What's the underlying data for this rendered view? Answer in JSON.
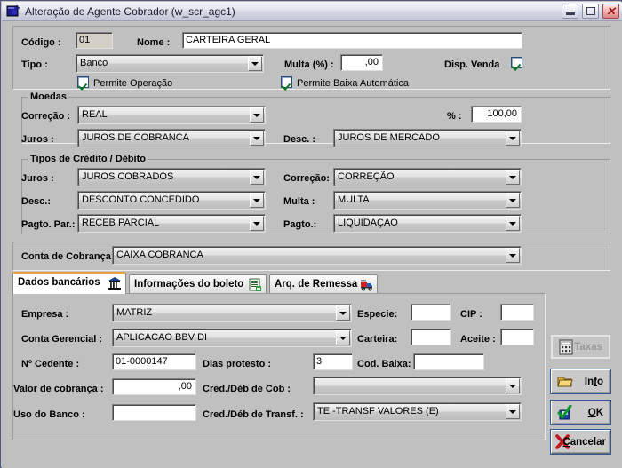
{
  "window": {
    "title": "Alteração de Agente Cobrador (w_scr_agc1)",
    "icon": "app-window-icon",
    "minimize": "minimize-icon",
    "maximize": "maximize-icon",
    "close": "close-icon"
  },
  "form": {
    "codigo_label": "Código :",
    "codigo_value": "01",
    "nome_label": "Nome :",
    "nome_value": "CARTEIRA GERAL",
    "tipo_label": "Tipo :",
    "tipo_value": "Banco",
    "multa_label": "Multa (%) :",
    "multa_value": ",00",
    "disp_venda_label": "Disp. Venda",
    "disp_venda_checked": true,
    "permite_operacao_label": "Permite Operação",
    "permite_operacao_checked": true,
    "permite_baixa_label": "Permite Baixa Automática",
    "permite_baixa_checked": true
  },
  "moedas": {
    "group_title": "Moedas",
    "correcao_label": "Correção :",
    "correcao_value": "REAL",
    "pct_label": "% :",
    "pct_value": "100,00",
    "juros_label": "Juros :",
    "juros_value": "JUROS DE COBRANCA",
    "desc_label": "Desc. :",
    "desc_value": "JUROS DE MERCADO"
  },
  "tipos_credito": {
    "group_title": "Tipos de Crédito / Débito",
    "juros_label": "Juros :",
    "juros_value": "JUROS COBRADOS",
    "correcao_label": "Correção:",
    "correcao_value": "CORREÇÃO",
    "desc_label": "Desc.:",
    "desc_value": "DESCONTO CONCEDIDO",
    "multa_label": "Multa :",
    "multa_value": "MULTA",
    "pagto_par_label": "Pagto. Par.:",
    "pagto_par_value": "RECEB PARCIAL",
    "pagto_label": "Pagto.:",
    "pagto_value": "LIQUIDAÇAO"
  },
  "conta_cobranca": {
    "label": "Conta de Cobrança:",
    "value": "CAIXA COBRANCA"
  },
  "tabs": [
    {
      "label": "Dados bancários",
      "icon": "bank-icon",
      "active": true
    },
    {
      "label": "Informações do boleto",
      "icon": "document-icon",
      "active": false
    },
    {
      "label": "Arq. de Remessa",
      "icon": "truck-icon",
      "active": false
    }
  ],
  "dados_bancarios": {
    "empresa_label": "Empresa :",
    "empresa_value": "MATRIZ",
    "especie_label": "Especie:",
    "especie_value": "",
    "cip_label": "CIP :",
    "cip_value": "",
    "conta_gerencial_label": "Conta Gerencial :",
    "conta_gerencial_value": "APLICACAO BBV DI",
    "carteira_label": "Carteira:",
    "carteira_value": "",
    "aceite_label": "Aceite :",
    "aceite_value": "",
    "cedente_label": "Nº Cedente :",
    "cedente_value": "01-0000147",
    "dias_protesto_label": "Dias protesto :",
    "dias_protesto_value": "3",
    "cod_baixa_label": "Cod. Baixa:",
    "cod_baixa_value": "",
    "valor_cobranca_label": "Valor de cobrança :",
    "valor_cobranca_value": ",00",
    "cred_deb_cob_label": "Cred./Déb de Cob :",
    "cred_deb_cob_value": "",
    "uso_banco_label": "Uso do Banco :",
    "uso_banco_value": "",
    "cred_deb_transf_label": "Cred./Déb de Transf. :",
    "cred_deb_transf_value": "TE -TRANSF VALORES (E)"
  },
  "buttons": {
    "taxas": {
      "label": "Taxas",
      "icon": "calculator-icon",
      "disabled": true
    },
    "info": {
      "label": "Info",
      "icon": "folder-icon",
      "disabled": false
    },
    "ok": {
      "label": "OK",
      "icon": "check-disk-icon",
      "disabled": false
    },
    "cancelar": {
      "label": "Cancelar",
      "icon": "red-x-icon",
      "disabled": false
    }
  },
  "colors": {
    "window_bg": "#c0c0c0",
    "accent_tab": "#e8a33d",
    "field_bg": "#ffffff",
    "readonly_bg": "#d4d0c8",
    "check_green": "#0a7a20",
    "close_red": "#a01c1c"
  }
}
